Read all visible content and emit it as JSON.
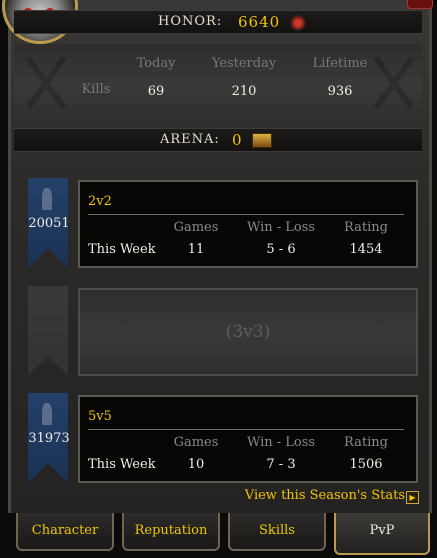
{
  "honor": {
    "label": "HONOR:",
    "value": "6640"
  },
  "kills": {
    "row_label": "Kills",
    "columns": [
      "Today",
      "Yesterday",
      "Lifetime"
    ],
    "values": [
      "69",
      "210",
      "936"
    ]
  },
  "arena": {
    "label": "ARENA:",
    "value": "0"
  },
  "teams": [
    {
      "name": "2v2",
      "team_rating": "20051",
      "row_label": "This Week",
      "columns": [
        "Games",
        "Win - Loss",
        "Rating"
      ],
      "values": [
        "11",
        "5 - 6",
        "1454"
      ]
    },
    {
      "empty_label": "(3v3)"
    },
    {
      "name": "5v5",
      "team_rating": "31973",
      "row_label": "This Week",
      "columns": [
        "Games",
        "Win - Loss",
        "Rating"
      ],
      "values": [
        "10",
        "7 - 3",
        "1506"
      ]
    }
  ],
  "link": {
    "season_stats": "View this Season's Stats"
  },
  "tabs": [
    "Character",
    "Reputation",
    "Skills",
    "PvP"
  ]
}
